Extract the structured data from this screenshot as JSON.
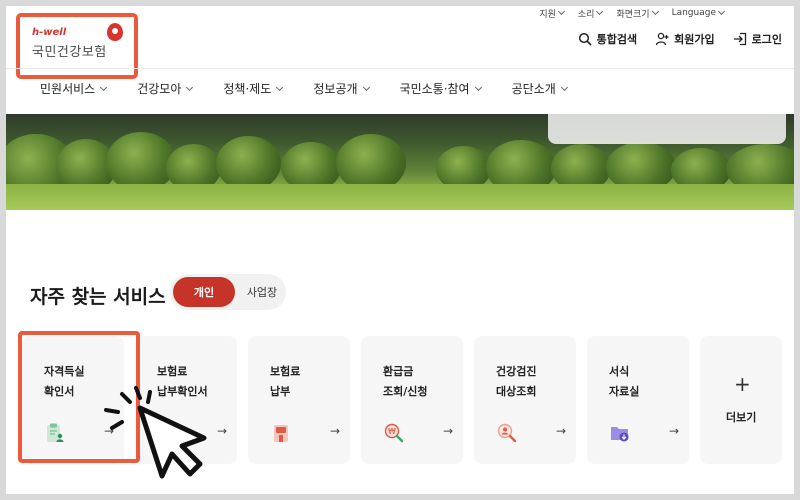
{
  "colors": {
    "brand_red": "#c63429",
    "highlight_orange": "#ec5a3c",
    "card_bg": "#f6f6f6"
  },
  "utility_bar": {
    "items": [
      {
        "label": "지원"
      },
      {
        "label": "소리"
      },
      {
        "label": "화면크기"
      },
      {
        "label": "Language"
      }
    ]
  },
  "logo": {
    "brand_en": "h-well",
    "brand_ko": "국민건강보험"
  },
  "header_actions": [
    {
      "label": "통합검색",
      "icon": "search-icon"
    },
    {
      "label": "회원가입",
      "icon": "user-plus-icon"
    },
    {
      "label": "로그인",
      "icon": "login-icon"
    }
  ],
  "nav": {
    "items": [
      {
        "label": "민원서비스"
      },
      {
        "label": "건강모아"
      },
      {
        "label": "정책·제도"
      },
      {
        "label": "정보공개"
      },
      {
        "label": "국민소통·참여"
      },
      {
        "label": "공단소개"
      }
    ]
  },
  "section": {
    "title": "자주 찾는 서비스",
    "toggle": {
      "active": "개인",
      "inactive": "사업장"
    }
  },
  "services": [
    {
      "label": "자격득실\n확인서",
      "icon": "clipboard-person-icon"
    },
    {
      "label": "보험료\n납부확인서",
      "icon": "document-icon"
    },
    {
      "label": "보험료\n납부",
      "icon": "payment-terminal-icon"
    },
    {
      "label": "환급금\n조회/신청",
      "icon": "magnifier-coin-icon"
    },
    {
      "label": "건강검진\n대상조회",
      "icon": "magnifier-person-icon"
    },
    {
      "label": "서식\n자료실",
      "icon": "folder-download-icon"
    }
  ],
  "more": {
    "label": "더보기",
    "symbol": "+"
  },
  "arrow_symbol": "→"
}
